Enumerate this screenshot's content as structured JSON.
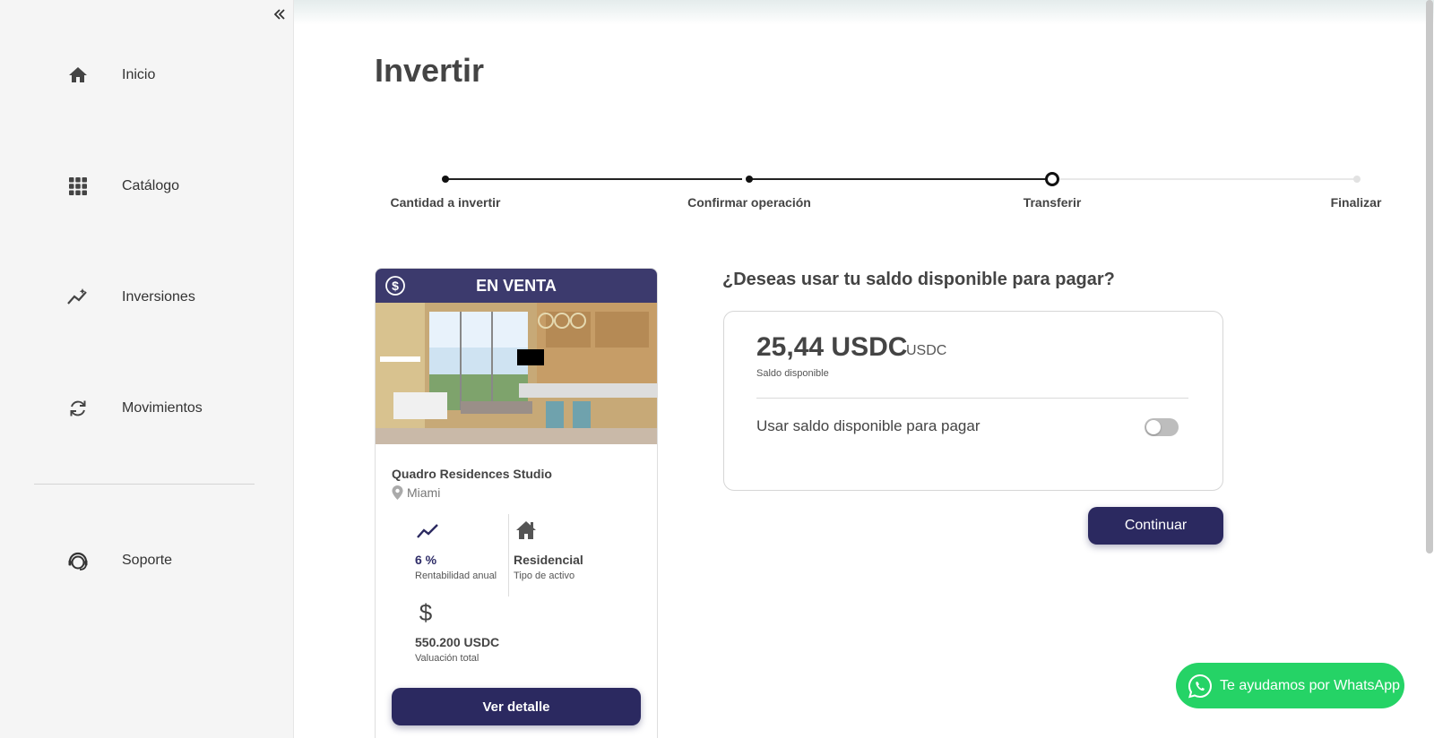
{
  "sidebar": {
    "collapse_icon": "double-chevron-left-icon",
    "items": [
      {
        "label": "Inicio",
        "icon": "home-icon"
      },
      {
        "label": "Catálogo",
        "icon": "grid-icon"
      },
      {
        "label": "Inversiones",
        "icon": "trending-up-icon"
      },
      {
        "label": "Movimientos",
        "icon": "sync-icon"
      },
      {
        "label": "Soporte",
        "icon": "support-agent-icon"
      }
    ]
  },
  "page": {
    "title": "Invertir"
  },
  "stepper": {
    "current_step": 3,
    "steps": [
      {
        "label": "Cantidad a invertir",
        "status": "done"
      },
      {
        "label": "Confirmar operación",
        "status": "done"
      },
      {
        "label": "Transferir",
        "status": "active"
      },
      {
        "label": "Finalizar",
        "status": "pending"
      }
    ]
  },
  "property_card": {
    "badge": "EN VENTA",
    "name": "Quadro Residences Studio",
    "location": "Miami",
    "stats": {
      "return_value": "6 %",
      "return_label": "Rentabilidad anual",
      "type_value": "Residencial",
      "type_label": "Tipo de activo",
      "valuation_value": "550.200 USDC",
      "valuation_label": "Valuación total"
    },
    "button_label": "Ver detalle"
  },
  "balance": {
    "question": "¿Deseas usar tu saldo disponible para pagar?",
    "amount": "25,44 USDC",
    "unit": "USDC",
    "caption": "Saldo disponible",
    "toggle_label": "Usar saldo disponible para pagar",
    "toggle_on": false,
    "continue_label": "Continuar"
  },
  "whatsapp": {
    "label": "Te ayudamos por WhatsApp"
  },
  "colors": {
    "primary": "#2b2960",
    "card_header": "#3c3a6d",
    "whatsapp": "#25d366",
    "sidebar_bg": "#f5f5f5"
  }
}
